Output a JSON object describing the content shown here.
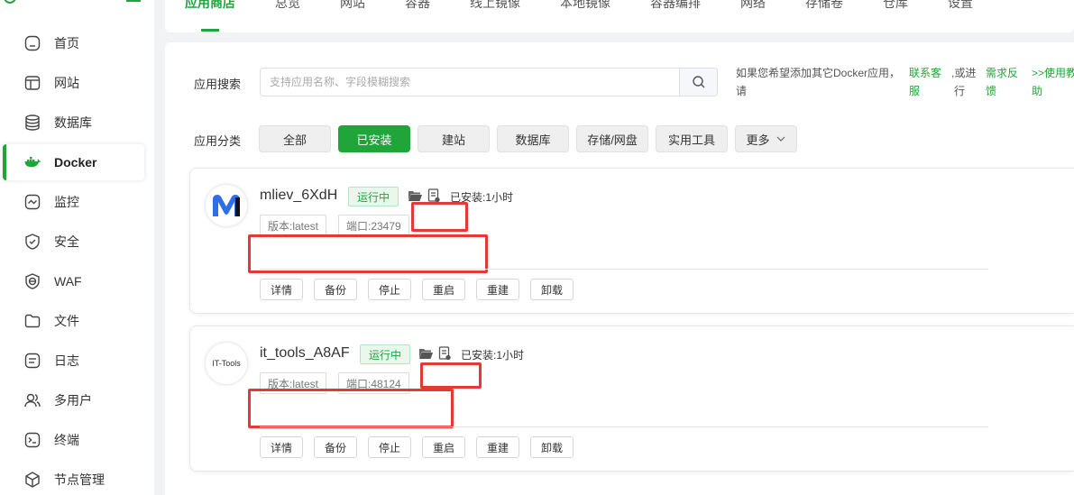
{
  "sidebar": {
    "items": [
      {
        "label": "首页",
        "icon": "home-icon"
      },
      {
        "label": "网站",
        "icon": "website-icon"
      },
      {
        "label": "数据库",
        "icon": "database-icon"
      },
      {
        "label": "Docker",
        "icon": "docker-icon",
        "active": true
      },
      {
        "label": "监控",
        "icon": "monitor-icon"
      },
      {
        "label": "安全",
        "icon": "shield-icon"
      },
      {
        "label": "WAF",
        "icon": "waf-icon"
      },
      {
        "label": "文件",
        "icon": "folder-icon"
      },
      {
        "label": "日志",
        "icon": "log-icon"
      },
      {
        "label": "多用户",
        "icon": "users-icon"
      },
      {
        "label": "终端",
        "icon": "terminal-icon"
      },
      {
        "label": "节点管理",
        "icon": "node-icon"
      }
    ]
  },
  "tabs": [
    "应用商店",
    "总览",
    "网站",
    "容器",
    "线上镜像",
    "本地镜像",
    "容器编排",
    "网络",
    "存储卷",
    "仓库",
    "设置"
  ],
  "search": {
    "label": "应用搜索",
    "placeholder": "支持应用名称、字段模糊搜索",
    "hint_text_1": "如果您希望添加其它Docker应用，",
    "hint_text_2": "请",
    "link_contact_1": "联系客",
    "link_contact_2": "服",
    "hint_or_1": ",或进",
    "hint_or_2": "行",
    "link_feedback_1": "需求反",
    "link_feedback_2": "馈",
    "link_tutorial_1": ">>使用教",
    "link_tutorial_2": "助"
  },
  "categories": {
    "label": "应用分类",
    "items": [
      "全部",
      "已安装",
      "建站",
      "数据库",
      "存储/网盘",
      "实用工具",
      "更多"
    ],
    "active": "已安装"
  },
  "apps": [
    {
      "name": "mliev_6XdH",
      "status": "运行中",
      "installed": "已安装:1小时",
      "version": "版本:latest",
      "port": "端口:23479",
      "actions": [
        "详情",
        "备份",
        "停止",
        "重启",
        "重建",
        "卸载"
      ]
    },
    {
      "name": "it_tools_A8AF",
      "status": "运行中",
      "installed": "已安装:1小时",
      "version": "版本:latest",
      "port": "端口:48124",
      "logo_text": "IT-Tools",
      "actions": [
        "详情",
        "备份",
        "停止",
        "重启",
        "重建",
        "卸载"
      ]
    }
  ],
  "colors": {
    "accent": "#20a53a",
    "highlight": "#e53935"
  }
}
